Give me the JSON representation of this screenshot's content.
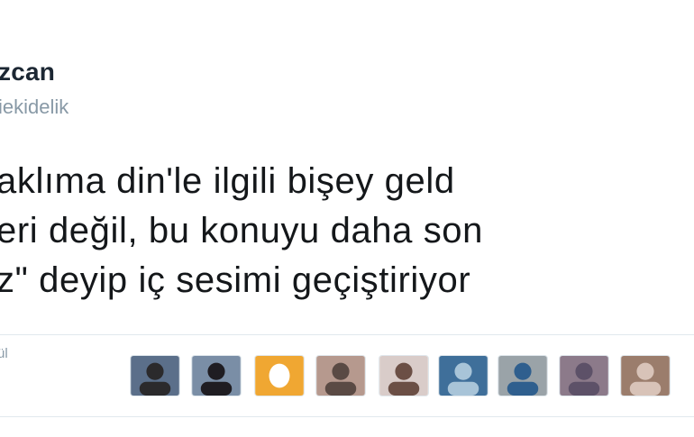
{
  "tweet": {
    "author_name": "zcan",
    "author_handle": "iekidelik",
    "text_lines": [
      "aklıma din'le ilgili bişey geld",
      "eri değil, bu konuyu daha son",
      "z\" deyip iç sesimi geçiştiriyor"
    ]
  },
  "stats": {
    "label": "ül"
  },
  "likers": [
    {
      "name": "liker-avatar-1",
      "bg": "#5b6f8a",
      "fg": "#2b2a2c"
    },
    {
      "name": "liker-avatar-2",
      "bg": "#7a8ea6",
      "fg": "#1f1d22"
    },
    {
      "name": "liker-avatar-3",
      "bg": "#f0a732",
      "fg": "#ffffff"
    },
    {
      "name": "liker-avatar-4",
      "bg": "#b6998e",
      "fg": "#5a4a44"
    },
    {
      "name": "liker-avatar-5",
      "bg": "#d9ccc9",
      "fg": "#6b4f45"
    },
    {
      "name": "liker-avatar-6",
      "bg": "#3f6f9a",
      "fg": "#a8c4d8"
    },
    {
      "name": "liker-avatar-7",
      "bg": "#9aa3a8",
      "fg": "#2f5f8e"
    },
    {
      "name": "liker-avatar-8",
      "bg": "#8c7a8a",
      "fg": "#5d5168"
    },
    {
      "name": "liker-avatar-9",
      "bg": "#9b7d6c",
      "fg": "#d8c3b8"
    }
  ],
  "colors": {
    "text": "#14171a",
    "secondary": "#8899a6",
    "divider": "#e1e8ed"
  }
}
